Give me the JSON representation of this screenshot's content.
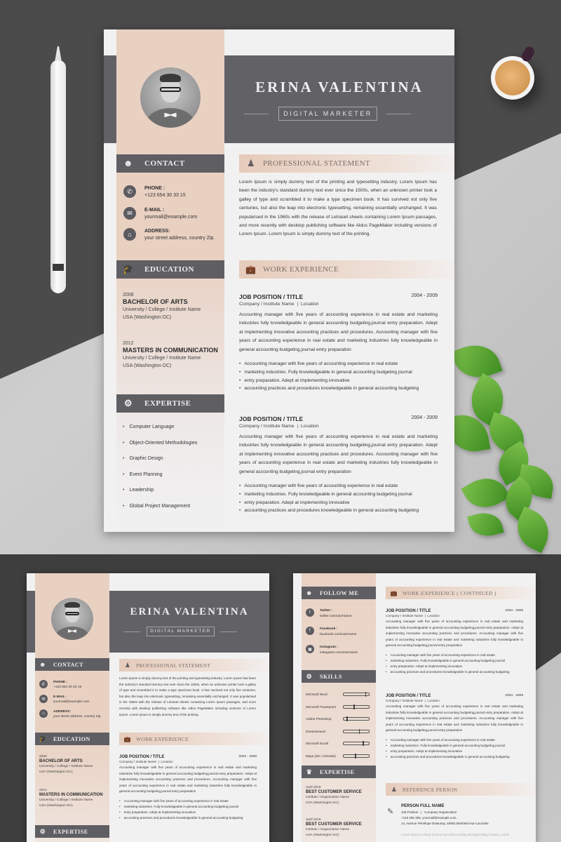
{
  "resume": {
    "name": "ERINA VALENTINA",
    "role": "DIGITAL MARKETER",
    "contact": {
      "heading": "CONTACT",
      "items": [
        {
          "icon": "phone-icon",
          "label": "PHONE :",
          "value": "+123 654 30 33 15"
        },
        {
          "icon": "email-icon",
          "label": "E-MAIL :",
          "value": "yourmail@example.com"
        },
        {
          "icon": "home-icon",
          "label": "ADDRESS:",
          "value": "your street address, country Zip."
        }
      ]
    },
    "education": {
      "heading": "EDUCATION",
      "items": [
        {
          "year": "2008",
          "degree": "BACHELOR OF ARTS",
          "school": "University / College / Institute Name",
          "location": "USA (Washington DC)"
        },
        {
          "year": "2012",
          "degree": "MASTERS IN COMMUNICATION",
          "school": "University / College / Institute Name",
          "location": "USA (Washington DC)"
        }
      ]
    },
    "expertise": {
      "heading": "EXPERTISE",
      "items": [
        "Computer Language",
        "Object-Oriented Methodologies",
        "Graphic Design",
        "Event Planning",
        "Leadership",
        "Global Project Management"
      ]
    },
    "statement": {
      "heading": "PROFESSIONAL STATEMENT",
      "text": "Lorem Ipsum is simply dummy text of the printing and typesetting industry. Lorem Ipsum has been the industry's standard dummy text ever since the 1500s, when an unknown printer took a galley of type and scrambled it to make a type specimen book. It has survived not only five centuries, but also the leap into electronic typesetting, remaining essentially unchanged. It was popularised in the 1960s with the release of Letraset sheets containing Lorem Ipsum passages, and more recently with desktop publishing software like Aldus PageMaker including versions of Lorem Ipsum. Lorem Ipsum is simply dummy text of the printing."
    },
    "work": {
      "heading": "WORK EXPERIENCE",
      "heading_continued": "WORK EXPERIENCE ( CONTINUED )",
      "jobs": [
        {
          "title": "JOB POSITION / TITLE",
          "dates": "2004 - 2009",
          "company": "Company / Institute Name  |  Location",
          "description": "Accounting manager with five years of accounting experience in real estate and marketing industries fully knowledgeable in general accounting budgeting,journal entry preparation. Adept at implementing innovative accounting practices and procedures. Accounting manager with five years of accounting experience in real estate and marketing industries fully knowledgeable in general accounting budgeting,journal entry preparation",
          "bullets": [
            "Accounting manager with five years of accounting experience in real estate",
            "marketing industries. Fully knowledgeable in general accounting budgeting journal",
            "entry preparation. Adept at implementing innovative",
            "accounting practices and procedures knowledgeable in general accounting budgeting"
          ]
        },
        {
          "title": "JOB POSITION / TITLE",
          "dates": "2004 - 2009",
          "company": "Company / Institute Name  |  Location",
          "description": "Accounting manager with five years of accounting experience in real estate and marketing industries fully knowledgeable in general accounting budgeting,journal entry preparation. Adept at implementing innovative accounting practices and procedures. Accounting manager with five years of accounting experience in real estate and marketing industries fully knowledgeable in general accounting budgeting,journal entry preparation",
          "bullets": [
            "Accounting manager with five years of accounting experience in real estate",
            "marketing industries. Fully knowledgeable in general accounting budgeting journal",
            "entry preparation. Adept at implementing innovative",
            "accounting practices and procedures knowledgeable in general accounting budgeting"
          ]
        }
      ]
    },
    "follow": {
      "heading": "FOLLOW ME",
      "items": [
        {
          "icon": "twitter-icon",
          "label": "Twitter :",
          "value": "twitter.com/username"
        },
        {
          "icon": "facebook-icon",
          "label": "Facebook :",
          "value": "facebook.com/username"
        },
        {
          "icon": "instagram-icon",
          "label": "Instagram :",
          "value": "instagram.com/username"
        }
      ]
    },
    "skills": {
      "heading": "SKILLS",
      "items": [
        {
          "name": "Microsoft Word",
          "level": 0.85
        },
        {
          "name": "Microsoft Powerpoint",
          "level": 0.4
        },
        {
          "name": "Adobe Photoshop",
          "level": 0.12
        },
        {
          "name": "Dreamweaver",
          "level": 0.6
        },
        {
          "name": "Microsoft Excell",
          "level": 0.75
        },
        {
          "name": "Maya (3D / Animatio)",
          "level": 0.45
        }
      ]
    },
    "awards": {
      "heading": "EXPERTISE",
      "items": [
        {
          "date": "April 2015",
          "title": "BEST CUSTOMER SERVICE",
          "org": "Institute / Organization Name",
          "location": "USA (Washington DC)"
        },
        {
          "date": "April 2015",
          "title": "BEST CUSTOMER SERVICE",
          "org": "Institute / Organization Name",
          "location": "USA (Washington DC)"
        }
      ]
    },
    "reference": {
      "heading": "REFERENCE PERSON",
      "name": "PERSON FULL NAME",
      "position": "Job Position   |   Company Organization",
      "contact": "+123 256 365, yourmail@example.com",
      "address": "14, Avenue Pénélope Delaunay, 45952 Berthelot-sur-Lacombe",
      "note": "Lorem Ipsum is simply dummy text of the printing and typesetting industry. Lorem"
    }
  },
  "colors": {
    "accent_peach": "#e9d1c2",
    "header_gray": "#626166",
    "paper": "#f2f1f1"
  }
}
